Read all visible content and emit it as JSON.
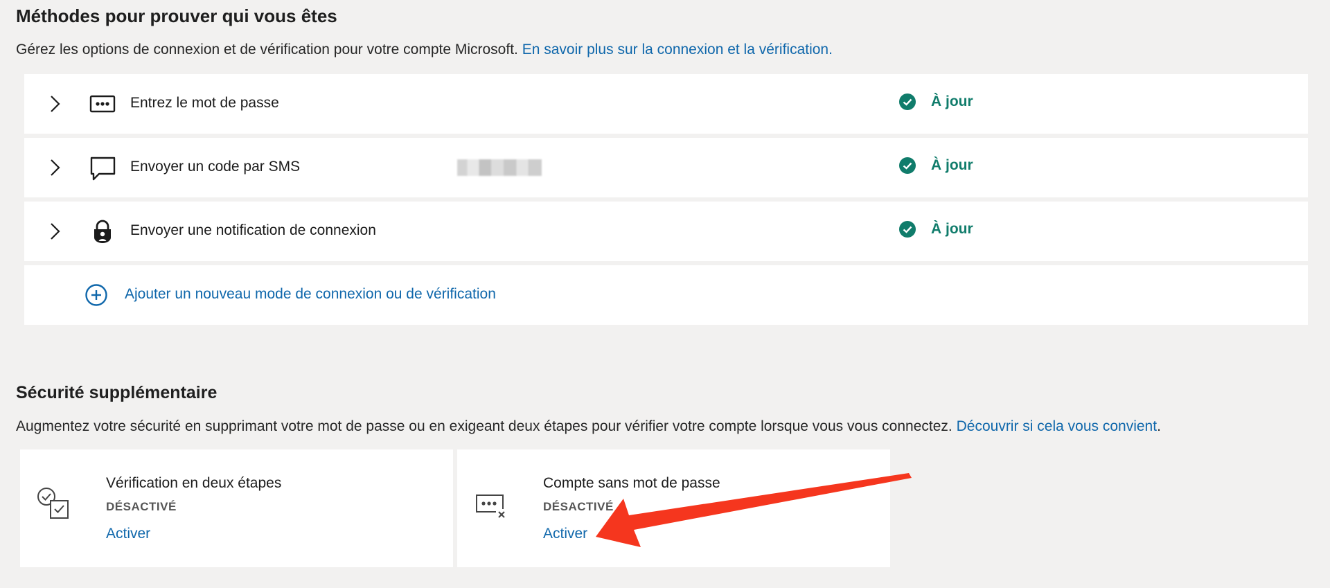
{
  "methods_section": {
    "title": "Méthodes pour prouver qui vous êtes",
    "description": "Gérez les options de connexion et de vérification pour votre compte Microsoft.",
    "learn_more_link": "En savoir plus sur la connexion et la vérification.",
    "items": [
      {
        "label": "Entrez le mot de passe",
        "icon": "password-dots-icon",
        "status": "À jour"
      },
      {
        "label": "Envoyer un code par SMS",
        "icon": "chat-bubble-icon",
        "status": "À jour"
      },
      {
        "label": "Envoyer une notification de connexion",
        "icon": "lock-person-icon",
        "status": "À jour"
      }
    ],
    "add_method_label": "Ajouter un nouveau mode de connexion ou de vérification"
  },
  "security_section": {
    "title": "Sécurité supplémentaire",
    "description": "Augmentez votre sécurité en supprimant votre mot de passe ou en exigeant deux étapes pour vérifier votre compte lorsque vous vous connectez.",
    "discover_link": "Découvrir si cela vous convient",
    "discover_suffix": ".",
    "cards": [
      {
        "title": "Vérification en deux étapes",
        "state": "DÉSACTIVÉ",
        "action": "Activer",
        "icon": "two-step-check-icon"
      },
      {
        "title": "Compte sans mot de passe",
        "state": "DÉSACTIVÉ",
        "action": "Activer",
        "icon": "passwordless-icon"
      }
    ]
  },
  "colors": {
    "background": "#f2f1f0",
    "link": "#0f67ab",
    "status_ok": "#107c6b",
    "annotation_arrow": "#f5361e"
  }
}
